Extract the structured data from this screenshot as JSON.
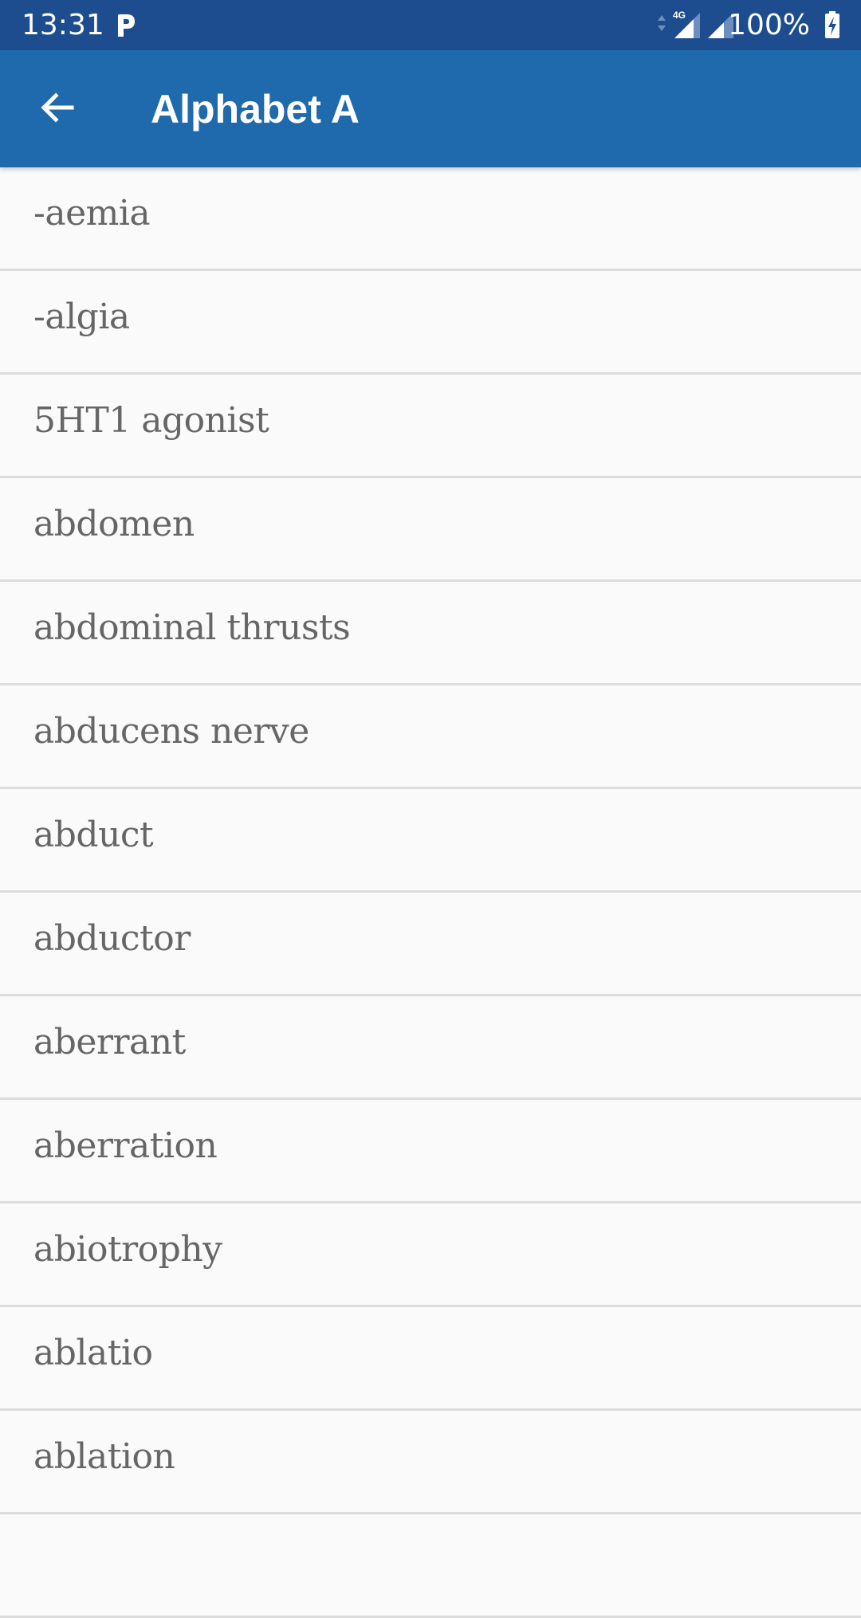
{
  "status_bar": {
    "time": "13:31",
    "notification_icon": "parking-p-icon",
    "network_label": "4G",
    "battery": "100%",
    "battery_state": "charging"
  },
  "app_bar": {
    "title": "Alphabet A",
    "back_icon": "arrow-back-icon",
    "background_color": "#1f6aad"
  },
  "list": {
    "items": [
      {
        "label": "-aemia"
      },
      {
        "label": "-algia"
      },
      {
        "label": "5HT1 agonist"
      },
      {
        "label": "abdomen"
      },
      {
        "label": "abdominal thrusts"
      },
      {
        "label": "abducens nerve"
      },
      {
        "label": "abduct"
      },
      {
        "label": "abductor"
      },
      {
        "label": "aberrant"
      },
      {
        "label": "aberration"
      },
      {
        "label": "abiotrophy"
      },
      {
        "label": "ablatio"
      },
      {
        "label": "ablation"
      },
      {
        "label": ""
      }
    ]
  }
}
